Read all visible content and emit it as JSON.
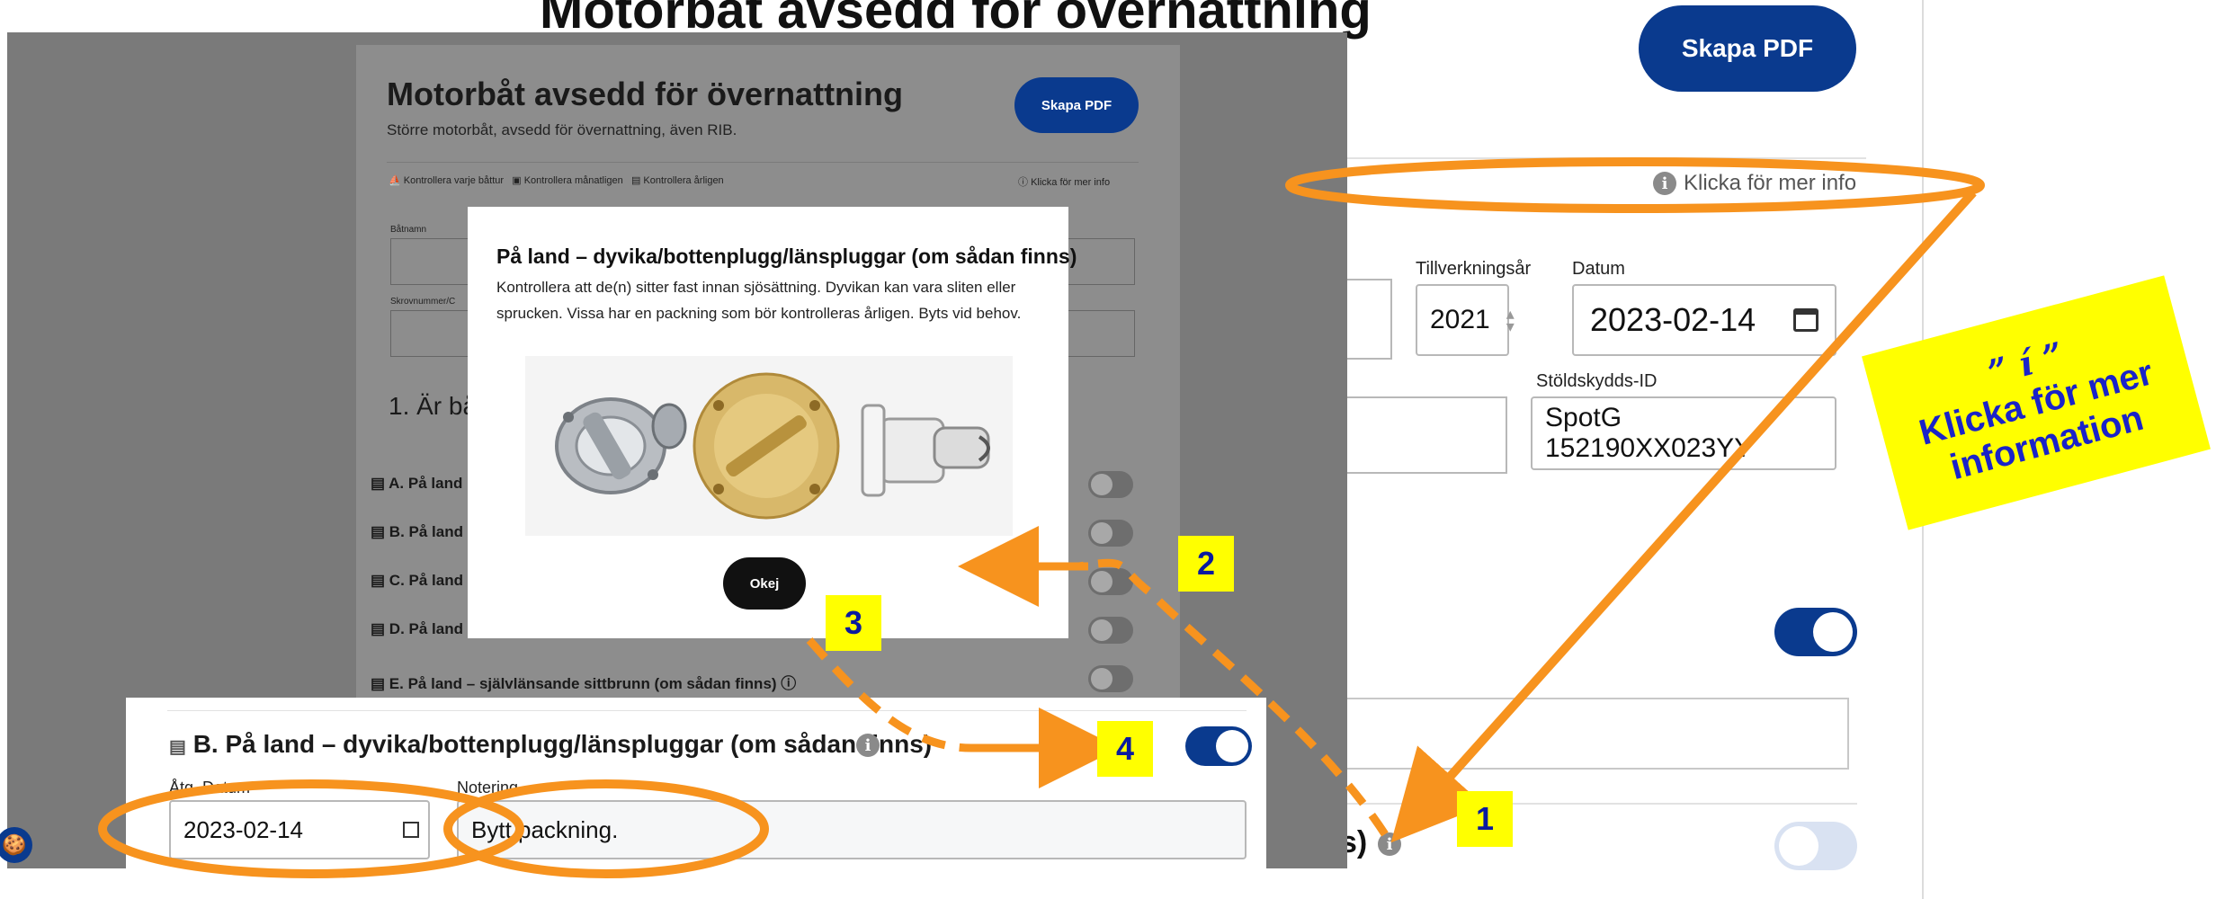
{
  "background_page": {
    "title": "Motorbåt avsedd för övernattning",
    "create_pdf": "Skapa PDF",
    "more_info": "Klicka för mer info",
    "labels": {
      "manufacture_year": "Tillverkningsår",
      "date": "Datum",
      "theft_id": "Stöldskydds-ID"
    },
    "manufacture_year": "2021",
    "date": "2023-02-14",
    "theft_id": "SpotG 152190XX023YY",
    "row_suffix": "s)"
  },
  "overlay_page": {
    "title": "Motorbåt avsedd för övernattning",
    "subtitle": "Större motorbåt, avsedd för övernattning, även RIB.",
    "create_pdf": "Skapa PDF",
    "legend": [
      "Kontrollera varje båttur",
      "Kontrollera månatligen",
      "Kontrollera årligen"
    ],
    "more_info": "Klicka för mer info",
    "field_labels": {
      "boat_name": "Båtnamn",
      "hull_number": "Skrovnummer/C"
    },
    "section_title": "1. Är bå",
    "rows": [
      "A. På land",
      "B. På land",
      "C. På land",
      "D. På land",
      "E. På land – självlänsande sittbrunn (om sådan finns)"
    ]
  },
  "modal": {
    "title": "På land – dyvika/bottenplugg/länspluggar (om sådan finns)",
    "text": "Kontrollera att de(n) sitter fast innan sjösättning. Dyvikan kan vara sliten eller sprucken. Vissa har en packning som bör kontrolleras årligen. Byts vid behov.",
    "ok": "Okej"
  },
  "zoom_row": {
    "title": "B. På land – dyvika/bottenplugg/länspluggar (om sådan finns)",
    "date_label": "Åtg. Datum",
    "note_label": "Notering",
    "date": "2023-02-14",
    "note": "Bytt packning."
  },
  "annotations": {
    "steps": [
      "1",
      "2",
      "3",
      "4"
    ],
    "callout_symbol": "” í ”",
    "callout_text": "Klicka för mer information",
    "accent_color": "#f7931e",
    "highlight_color": "#ffff00"
  }
}
